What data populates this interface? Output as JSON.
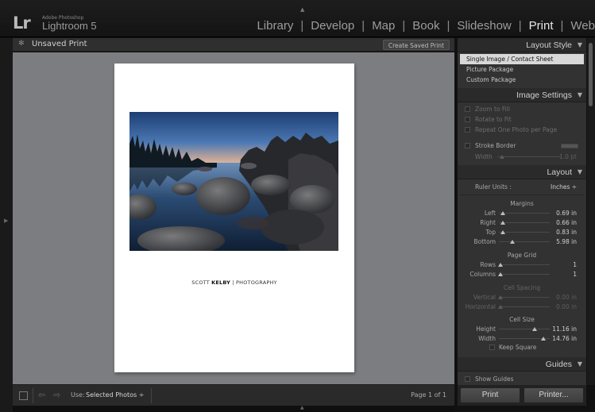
{
  "app": {
    "logo_mark": "Lr",
    "logo_vendor": "Adobe Photoshop",
    "logo_name": "Lightroom 5"
  },
  "modules": [
    {
      "label": "Library",
      "active": false
    },
    {
      "label": "Develop",
      "active": false
    },
    {
      "label": "Map",
      "active": false
    },
    {
      "label": "Book",
      "active": false
    },
    {
      "label": "Slideshow",
      "active": false
    },
    {
      "label": "Print",
      "active": true
    },
    {
      "label": "Web",
      "active": false
    }
  ],
  "module_separator": "|",
  "header": {
    "title": "Unsaved Print",
    "create_button": "Create Saved Print",
    "gear_icon": "gear-icon"
  },
  "print_page": {
    "caption_first": "SCOTT ",
    "caption_bold": "KELBY",
    "caption_rest": " | PHOTOGRAPHY"
  },
  "toolbar": {
    "use_label": "Use:",
    "use_value": "Selected Photos ÷",
    "page_info": "Page 1 of 1"
  },
  "panel": {
    "layout_style": {
      "title": "Layout Style",
      "items": [
        {
          "label": "Single Image / Contact Sheet",
          "selected": true
        },
        {
          "label": "Picture Package",
          "selected": false
        },
        {
          "label": "Custom Package",
          "selected": false
        }
      ]
    },
    "image_settings": {
      "title": "Image Settings",
      "zoom_to_fill": "Zoom to Fill",
      "rotate_to_fit": "Rotate to Fit",
      "repeat_one": "Repeat One Photo per Page",
      "stroke_border": "Stroke Border",
      "width_label": "Width",
      "width_value": "1.0 pt"
    },
    "layout": {
      "title": "Layout",
      "ruler_units_label": "Ruler Units :",
      "ruler_units_value": "Inches ÷",
      "margins_title": "Margins",
      "margins": [
        {
          "label": "Left",
          "value": "0.69 in",
          "level": 0.05
        },
        {
          "label": "Right",
          "value": "0.66 in",
          "level": 0.05
        },
        {
          "label": "Top",
          "value": "0.83 in",
          "level": 0.05
        },
        {
          "label": "Bottom",
          "value": "5.98 in",
          "level": 0.25
        }
      ],
      "page_grid_title": "Page Grid",
      "page_grid": [
        {
          "label": "Rows",
          "value": "1",
          "level": 0.0
        },
        {
          "label": "Columns",
          "value": "1",
          "level": 0.0
        }
      ],
      "cell_spacing_title": "Cell Spacing",
      "cell_spacing": [
        {
          "label": "Vertical",
          "value": "0.00 in",
          "level": 0.0
        },
        {
          "label": "Horizontal",
          "value": "0.00 in",
          "level": 0.0
        }
      ],
      "cell_size_title": "Cell Size",
      "cell_size": [
        {
          "label": "Height",
          "value": "11.16 in",
          "level": 0.72
        },
        {
          "label": "Width",
          "value": "14.76 in",
          "level": 0.9
        }
      ],
      "keep_square": "Keep Square"
    },
    "guides": {
      "title": "Guides",
      "show_guides": "Show Guides"
    },
    "collapse_arrow": "▼"
  },
  "buttons": {
    "print": "Print",
    "printer": "Printer..."
  },
  "colors": {
    "canvas": "#7c7d80",
    "panel": "#323232",
    "active_module": "#e6e6e6"
  }
}
